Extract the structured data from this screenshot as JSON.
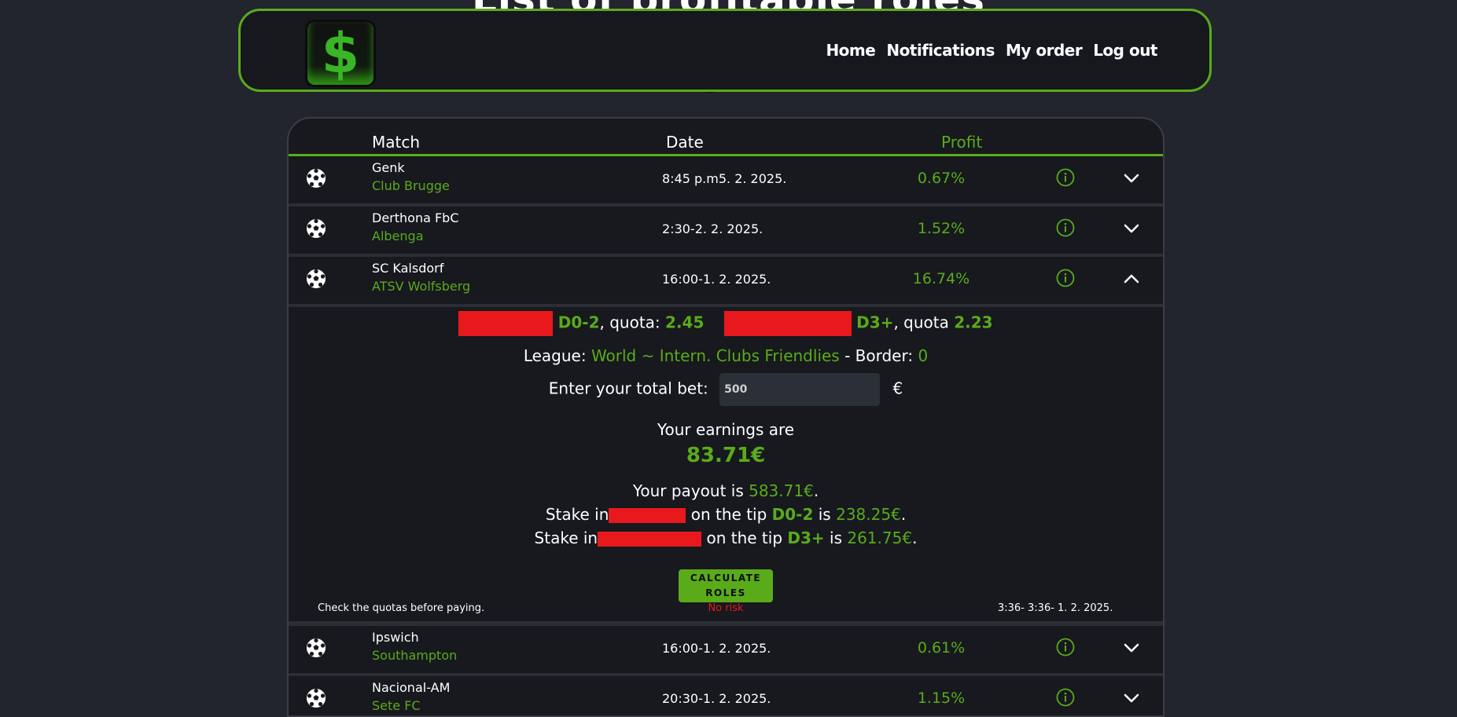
{
  "page": {
    "background_title": "List of profitable roles"
  },
  "nav": {
    "logo_symbol": "$",
    "links": [
      "Home",
      "Notifications",
      "My order",
      "Log out"
    ]
  },
  "colors": {
    "accent": "#5aab1a",
    "danger": "#e8191d",
    "background": "#22252e",
    "panel": "#17191e"
  },
  "table": {
    "headers": {
      "match": "Match",
      "date": "Date",
      "profit": "Profit"
    },
    "rows": [
      {
        "team1": "Genk",
        "team2": "Club Brugge",
        "date": "8:45 p.m5. 2. 2025.",
        "profit": "0.67%",
        "expanded": false
      },
      {
        "team1": "Derthona FbC",
        "team2": "Albenga",
        "date": "2:30-2. 2. 2025.",
        "profit": "1.52%",
        "expanded": false
      },
      {
        "team1": "SC Kalsdorf",
        "team2": "ATSV Wolfsberg",
        "date": "16:00-1. 2. 2025.",
        "profit": "16.74%",
        "expanded": true
      },
      {
        "team1": "Ipswich",
        "team2": "Southampton",
        "date": "16:00-1. 2. 2025.",
        "profit": "0.61%",
        "expanded": false
      },
      {
        "team1": "Nacional-AM",
        "team2": "Sete FC",
        "date": "20:30-1. 2. 2025.",
        "profit": "1.15%",
        "expanded": false
      }
    ]
  },
  "details": {
    "tip1": "D0-2",
    "quota1_label": ", quota: ",
    "quota1": "2.45",
    "tip2": "D3+",
    "quota2_label": ", quota ",
    "quota2": "2.23",
    "league_label": "League: ",
    "league": "World ~ Intern. Clubs Friendlies",
    "border_label": " - Border: ",
    "border": "0",
    "bet_label": "Enter your total bet:",
    "bet_value": "500",
    "currency": "€",
    "earnings_label": "Your earnings are",
    "earnings": "83.71€",
    "payout_label": "Your payout is ",
    "payout": "583.71€",
    "period": ".",
    "stake_label": "Stake in",
    "on_tip": "on the tip ",
    "is": " is ",
    "stake1": "238.25€",
    "stake2": "261.75€",
    "calc_button": "CALCULATE ROLES",
    "note_left": "Check the quotas before paying.",
    "note_center": "No risk",
    "note_right": "3:36- 3:36- 1. 2. 2025."
  }
}
